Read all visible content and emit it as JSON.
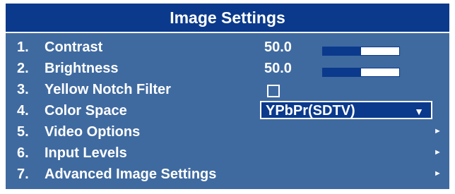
{
  "title": "Image Settings",
  "colors": {
    "title_bg": "#0b3a8c",
    "panel_bg": "#3f6aa0",
    "text": "#ffffff",
    "slider_fill": "#0b3a8c"
  },
  "items": [
    {
      "number": "1.",
      "label": "Contrast",
      "value": "50.0",
      "level": 0.5,
      "control": "slider"
    },
    {
      "number": "2.",
      "label": "Brightness",
      "value": "50.0",
      "level": 0.5,
      "control": "slider"
    },
    {
      "number": "3.",
      "label": "Yellow Notch Filter",
      "checked": false,
      "control": "checkbox"
    },
    {
      "number": "4.",
      "label": "Color Space",
      "selected": "YPbPr(SDTV)",
      "arrow_icon": "dropdown-arrow-icon",
      "arrow": "▼",
      "control": "dropdown"
    },
    {
      "number": "5.",
      "label": "Video Options",
      "arrow_icon": "submenu-arrow-icon",
      "arrow": "►",
      "control": "submenu"
    },
    {
      "number": "6.",
      "label": "Input Levels",
      "arrow_icon": "submenu-arrow-icon",
      "arrow": "►",
      "control": "submenu"
    },
    {
      "number": "7.",
      "label": "Advanced Image Settings",
      "arrow_icon": "submenu-arrow-icon",
      "arrow": "►",
      "control": "submenu"
    }
  ]
}
